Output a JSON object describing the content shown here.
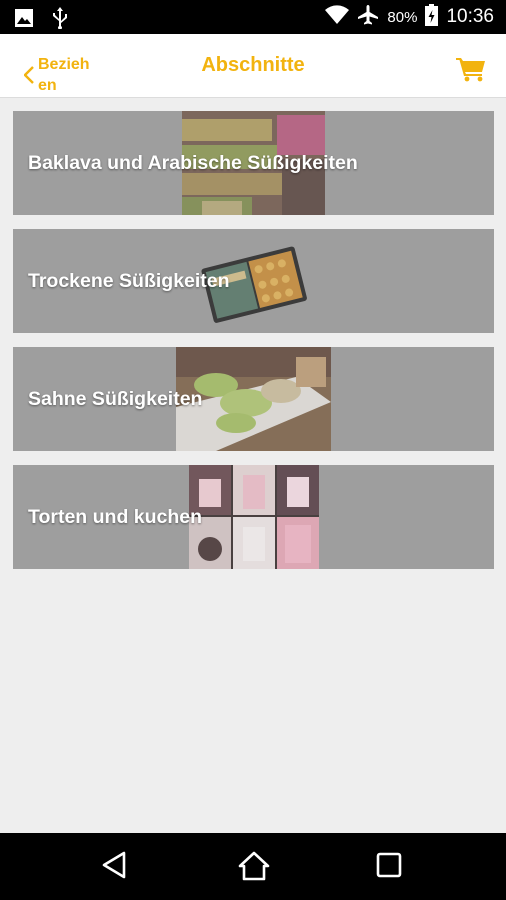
{
  "status_bar": {
    "battery_percent": "80%",
    "time": "10:36",
    "icons": [
      "image-icon",
      "usb-icon",
      "wifi-icon",
      "airplane-icon",
      "battery-icon"
    ]
  },
  "app_bar": {
    "back_label": "Beziehen",
    "title": "Abschnitte",
    "cart_icon": "shopping-cart-icon"
  },
  "sections": [
    {
      "label": "Baklava und Arabische Süßigkeiten",
      "image": "baklava-trays-photo"
    },
    {
      "label": "Trockene Süßigkeiten",
      "image": "dry-sweets-box-photo"
    },
    {
      "label": "Sahne Süßigkeiten",
      "image": "cream-sweets-plate-photo"
    },
    {
      "label": "Torten und kuchen",
      "image": "cakes-collage-photo"
    }
  ],
  "nav_bar": {
    "buttons": [
      "back-triangle-icon",
      "home-icon",
      "recents-square-icon"
    ]
  },
  "colors": {
    "accent": "#f2b30f",
    "item_background": "#9e9e9e",
    "page_background": "#eeeeee"
  }
}
